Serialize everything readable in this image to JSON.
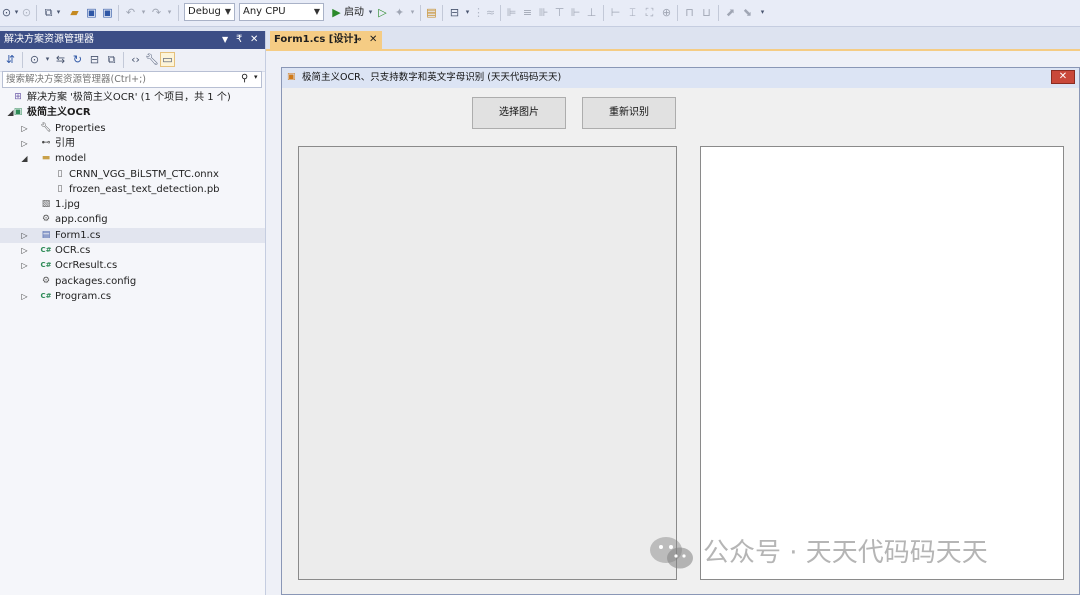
{
  "toolbar": {
    "config": "Debug",
    "platform": "Any CPU",
    "start_label": "启动"
  },
  "solution_explorer": {
    "title": "解决方案资源管理器",
    "search_placeholder": "搜索解决方案资源管理器(Ctrl+;)",
    "pin_glyph": "₹",
    "close_glyph": "✕",
    "tree": [
      {
        "label": "解决方案 '极简主义OCR' (1 个项目，共 1 个)",
        "icon": "solution-icon",
        "level": 0,
        "expand": ""
      },
      {
        "label": "极简主义OCR",
        "icon": "csharp-project-icon",
        "level": 0,
        "expand": "expanded",
        "bold": true
      },
      {
        "label": "Properties",
        "icon": "wrench-icon",
        "level": 1,
        "expand": "collapsed"
      },
      {
        "label": "引用",
        "icon": "references-icon",
        "level": 1,
        "expand": "collapsed"
      },
      {
        "label": "model",
        "icon": "folder-icon",
        "level": 1,
        "expand": "expanded"
      },
      {
        "label": "CRNN_VGG_BiLSTM_CTC.onnx",
        "icon": "file-icon",
        "level": 2,
        "expand": ""
      },
      {
        "label": "frozen_east_text_detection.pb",
        "icon": "file-icon",
        "level": 2,
        "expand": ""
      },
      {
        "label": "1.jpg",
        "icon": "image-file-icon",
        "level": 1,
        "expand": ""
      },
      {
        "label": "app.config",
        "icon": "config-file-icon",
        "level": 1,
        "expand": ""
      },
      {
        "label": "Form1.cs",
        "icon": "form-icon",
        "level": 1,
        "expand": "collapsed",
        "selected": true
      },
      {
        "label": "OCR.cs",
        "icon": "csharp-file-icon",
        "level": 1,
        "expand": "collapsed"
      },
      {
        "label": "OcrResult.cs",
        "icon": "csharp-file-icon",
        "level": 1,
        "expand": "collapsed"
      },
      {
        "label": "packages.config",
        "icon": "config-file-icon",
        "level": 1,
        "expand": ""
      },
      {
        "label": "Program.cs",
        "icon": "csharp-file-icon",
        "level": 1,
        "expand": "collapsed"
      }
    ]
  },
  "designer": {
    "tab_label": "Form1.cs [设计]",
    "form_title": "极简主义OCR、只支持数字和英文字母识别 (天天代码码天天)",
    "buttons": {
      "select_image": "选择图片",
      "re_recognize": "重新识别"
    }
  },
  "watermark": {
    "text": "公众号 · 天天代码码天天"
  },
  "colors": {
    "accent_title": "#3c4e86",
    "tab_active": "#f5cc84",
    "close_red": "#c9483a"
  }
}
